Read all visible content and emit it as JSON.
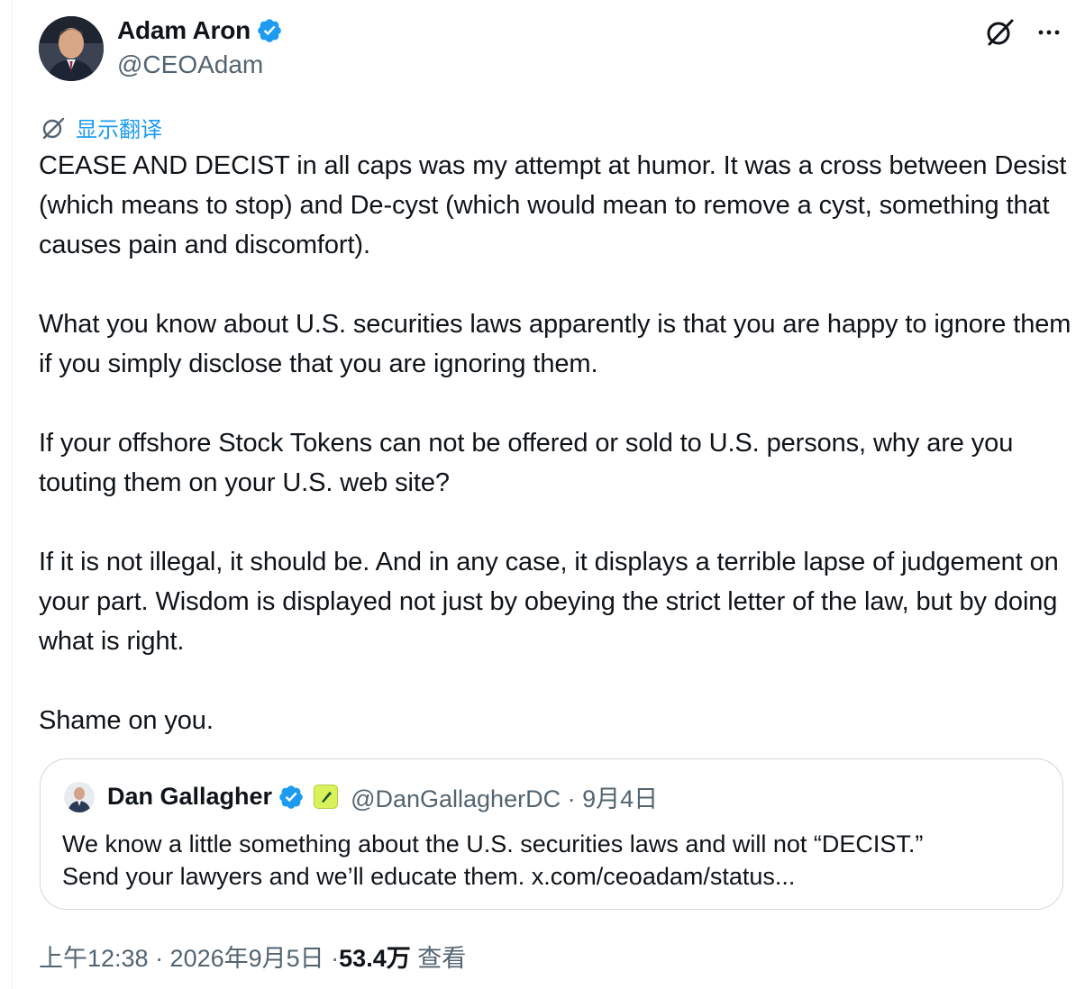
{
  "author": {
    "name": "Adam Aron",
    "handle": "@CEOAdam"
  },
  "translate_label": "显示翻译",
  "tweet": {
    "paragraphs": [
      "CEASE AND DECIST in all caps was my attempt at humor.  It was a cross between Desist (which means to stop) and De-cyst (which would mean to remove a cyst, something that causes pain and discomfort).",
      "What you know about U.S. securities laws apparently is that you are happy to ignore them if you simply disclose that you are ignoring them.",
      "If your offshore Stock Tokens can not be offered or sold to U.S. persons, why are you touting them on your U.S. web site?",
      "If it is not illegal, it should be. And in any case, it displays a terrible lapse of judgement on your part. Wisdom is displayed not just by obeying the strict letter of the law, but by doing what is right.",
      "Shame on you."
    ]
  },
  "quote": {
    "name": "Dan Gallagher",
    "handle_date": "@DanGallagherDC · 9月4日",
    "line1": "We know a little something about the U.S. securities laws and will not “DECIST.”",
    "line2": "Send your lawyers and we’ll educate them. x.com/ceoadam/status..."
  },
  "meta": {
    "time_date": "上午12:38 · 2026年9月5日 · ",
    "views": "53.4万",
    "views_label": " 查看"
  },
  "colors": {
    "accent": "#1d9bf0",
    "secondary_text": "#536471",
    "border": "#cfd9de",
    "badge_yellow": "#d9f25c"
  },
  "icons": [
    "verified-badge-icon",
    "grok-icon",
    "more-icon",
    "translate-icon",
    "org-badge-icon"
  ]
}
